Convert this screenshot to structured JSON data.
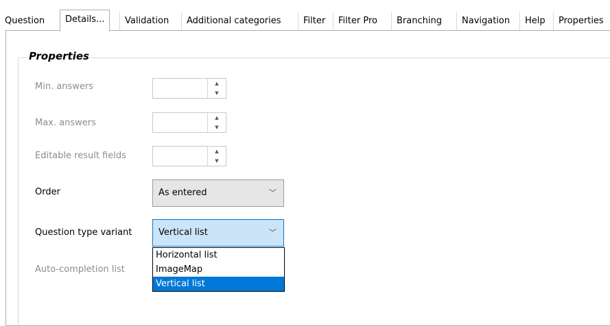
{
  "tabs": [
    {
      "label": "Question"
    },
    {
      "label": "Details..."
    },
    {
      "label": "Validation"
    },
    {
      "label": "Additional categories"
    },
    {
      "label": "Filter"
    },
    {
      "label": "Filter Pro"
    },
    {
      "label": "Branching"
    },
    {
      "label": "Navigation"
    },
    {
      "label": "Help"
    },
    {
      "label": "Properties"
    }
  ],
  "active_tab": "Details...",
  "group": {
    "title": "Properties"
  },
  "fields": {
    "min_answers": {
      "label": "Min. answers",
      "value": ""
    },
    "max_answers": {
      "label": "Max. answers",
      "value": ""
    },
    "editable_result_fields": {
      "label": "Editable result fields",
      "value": ""
    },
    "order": {
      "label": "Order",
      "value": "As entered"
    },
    "question_type_variant": {
      "label": "Question type variant",
      "value": "Vertical list"
    },
    "auto_completion_list": {
      "label": "Auto-completion list"
    }
  },
  "dropdown": {
    "options": [
      "Horizontal list",
      "ImageMap",
      "Vertical list"
    ],
    "selected": "Vertical list"
  },
  "colors": {
    "selection": "#0078d7",
    "focus_fill": "#cce4f7",
    "disabled_text": "#8c8c8c"
  }
}
